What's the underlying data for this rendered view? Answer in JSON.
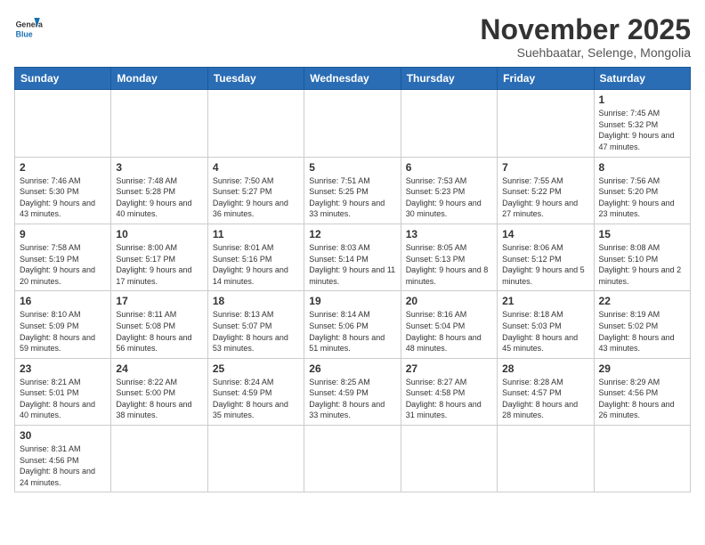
{
  "header": {
    "logo_general": "General",
    "logo_blue": "Blue",
    "month_title": "November 2025",
    "location": "Suehbaatar, Selenge, Mongolia"
  },
  "weekdays": [
    "Sunday",
    "Monday",
    "Tuesday",
    "Wednesday",
    "Thursday",
    "Friday",
    "Saturday"
  ],
  "weeks": [
    [
      {
        "day": "",
        "info": ""
      },
      {
        "day": "",
        "info": ""
      },
      {
        "day": "",
        "info": ""
      },
      {
        "day": "",
        "info": ""
      },
      {
        "day": "",
        "info": ""
      },
      {
        "day": "",
        "info": ""
      },
      {
        "day": "1",
        "info": "Sunrise: 7:45 AM\nSunset: 5:32 PM\nDaylight: 9 hours and 47 minutes."
      }
    ],
    [
      {
        "day": "2",
        "info": "Sunrise: 7:46 AM\nSunset: 5:30 PM\nDaylight: 9 hours and 43 minutes."
      },
      {
        "day": "3",
        "info": "Sunrise: 7:48 AM\nSunset: 5:28 PM\nDaylight: 9 hours and 40 minutes."
      },
      {
        "day": "4",
        "info": "Sunrise: 7:50 AM\nSunset: 5:27 PM\nDaylight: 9 hours and 36 minutes."
      },
      {
        "day": "5",
        "info": "Sunrise: 7:51 AM\nSunset: 5:25 PM\nDaylight: 9 hours and 33 minutes."
      },
      {
        "day": "6",
        "info": "Sunrise: 7:53 AM\nSunset: 5:23 PM\nDaylight: 9 hours and 30 minutes."
      },
      {
        "day": "7",
        "info": "Sunrise: 7:55 AM\nSunset: 5:22 PM\nDaylight: 9 hours and 27 minutes."
      },
      {
        "day": "8",
        "info": "Sunrise: 7:56 AM\nSunset: 5:20 PM\nDaylight: 9 hours and 23 minutes."
      }
    ],
    [
      {
        "day": "9",
        "info": "Sunrise: 7:58 AM\nSunset: 5:19 PM\nDaylight: 9 hours and 20 minutes."
      },
      {
        "day": "10",
        "info": "Sunrise: 8:00 AM\nSunset: 5:17 PM\nDaylight: 9 hours and 17 minutes."
      },
      {
        "day": "11",
        "info": "Sunrise: 8:01 AM\nSunset: 5:16 PM\nDaylight: 9 hours and 14 minutes."
      },
      {
        "day": "12",
        "info": "Sunrise: 8:03 AM\nSunset: 5:14 PM\nDaylight: 9 hours and 11 minutes."
      },
      {
        "day": "13",
        "info": "Sunrise: 8:05 AM\nSunset: 5:13 PM\nDaylight: 9 hours and 8 minutes."
      },
      {
        "day": "14",
        "info": "Sunrise: 8:06 AM\nSunset: 5:12 PM\nDaylight: 9 hours and 5 minutes."
      },
      {
        "day": "15",
        "info": "Sunrise: 8:08 AM\nSunset: 5:10 PM\nDaylight: 9 hours and 2 minutes."
      }
    ],
    [
      {
        "day": "16",
        "info": "Sunrise: 8:10 AM\nSunset: 5:09 PM\nDaylight: 8 hours and 59 minutes."
      },
      {
        "day": "17",
        "info": "Sunrise: 8:11 AM\nSunset: 5:08 PM\nDaylight: 8 hours and 56 minutes."
      },
      {
        "day": "18",
        "info": "Sunrise: 8:13 AM\nSunset: 5:07 PM\nDaylight: 8 hours and 53 minutes."
      },
      {
        "day": "19",
        "info": "Sunrise: 8:14 AM\nSunset: 5:06 PM\nDaylight: 8 hours and 51 minutes."
      },
      {
        "day": "20",
        "info": "Sunrise: 8:16 AM\nSunset: 5:04 PM\nDaylight: 8 hours and 48 minutes."
      },
      {
        "day": "21",
        "info": "Sunrise: 8:18 AM\nSunset: 5:03 PM\nDaylight: 8 hours and 45 minutes."
      },
      {
        "day": "22",
        "info": "Sunrise: 8:19 AM\nSunset: 5:02 PM\nDaylight: 8 hours and 43 minutes."
      }
    ],
    [
      {
        "day": "23",
        "info": "Sunrise: 8:21 AM\nSunset: 5:01 PM\nDaylight: 8 hours and 40 minutes."
      },
      {
        "day": "24",
        "info": "Sunrise: 8:22 AM\nSunset: 5:00 PM\nDaylight: 8 hours and 38 minutes."
      },
      {
        "day": "25",
        "info": "Sunrise: 8:24 AM\nSunset: 4:59 PM\nDaylight: 8 hours and 35 minutes."
      },
      {
        "day": "26",
        "info": "Sunrise: 8:25 AM\nSunset: 4:59 PM\nDaylight: 8 hours and 33 minutes."
      },
      {
        "day": "27",
        "info": "Sunrise: 8:27 AM\nSunset: 4:58 PM\nDaylight: 8 hours and 31 minutes."
      },
      {
        "day": "28",
        "info": "Sunrise: 8:28 AM\nSunset: 4:57 PM\nDaylight: 8 hours and 28 minutes."
      },
      {
        "day": "29",
        "info": "Sunrise: 8:29 AM\nSunset: 4:56 PM\nDaylight: 8 hours and 26 minutes."
      }
    ],
    [
      {
        "day": "30",
        "info": "Sunrise: 8:31 AM\nSunset: 4:56 PM\nDaylight: 8 hours and 24 minutes."
      },
      {
        "day": "",
        "info": ""
      },
      {
        "day": "",
        "info": ""
      },
      {
        "day": "",
        "info": ""
      },
      {
        "day": "",
        "info": ""
      },
      {
        "day": "",
        "info": ""
      },
      {
        "day": "",
        "info": ""
      }
    ]
  ]
}
